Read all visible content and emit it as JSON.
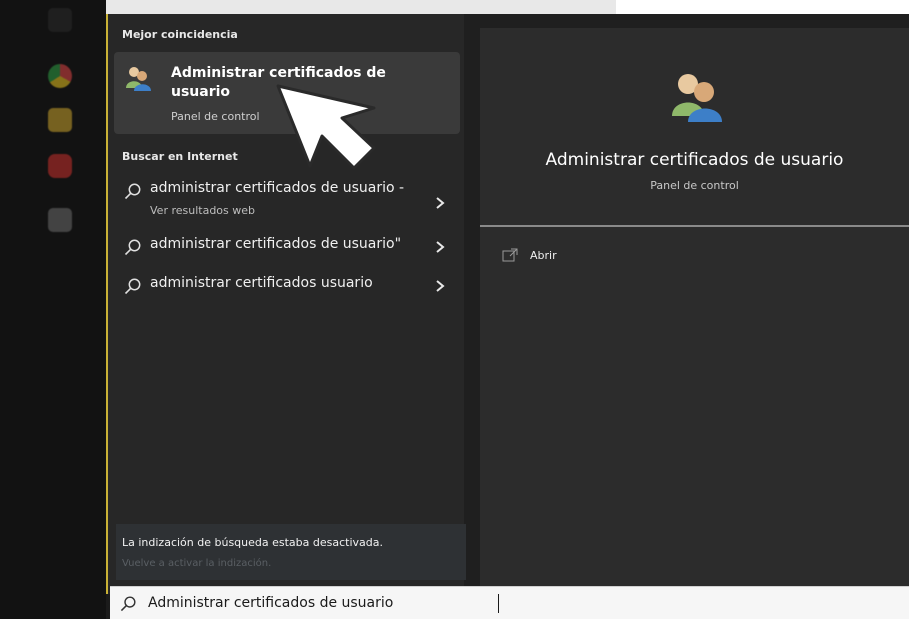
{
  "taskbar": {
    "icons": [
      "search-icon",
      "chrome-icon",
      "file-explorer-icon",
      "brave-icon",
      "discord-icon"
    ]
  },
  "search_results": {
    "best_match_label": "Mejor coincidencia",
    "best_match": {
      "title": "Administrar certificados de usuario",
      "subtitle": "Panel de control",
      "icon": "users-icon"
    },
    "internet_label": "Buscar en Internet",
    "web_results": [
      {
        "text": "administrar certificados de usuario -",
        "sub": "Ver resultados web"
      },
      {
        "text": "administrar certificados de usuario\"",
        "sub": ""
      },
      {
        "text": "administrar certificados usuario",
        "sub": ""
      }
    ],
    "indexing_notice": "La indización de búsqueda estaba desactivada.",
    "indexing_link": "Vuelve a activar la indización."
  },
  "detail": {
    "title": "Administrar certificados de usuario",
    "subtitle": "Panel de control",
    "actions": [
      {
        "label": "Abrir",
        "icon": "open-window-icon"
      }
    ]
  },
  "searchbar": {
    "value": "Administrar certificados de usuario",
    "icon": "search-icon"
  },
  "colors": {
    "accent_border": "#c9b236",
    "panel_bg": "#272727",
    "detail_bg": "#2c2c2c",
    "selected_bg": "#3a3a3a"
  }
}
